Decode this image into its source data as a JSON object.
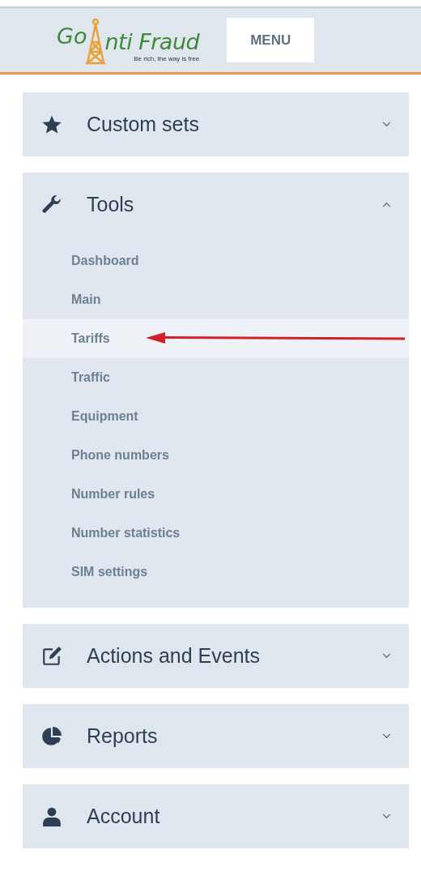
{
  "header": {
    "logo": {
      "part_1": "Go",
      "part_2": "nti Fraud",
      "tagline": "Be rich, the way is free"
    },
    "menu_button": "MENU"
  },
  "sections": [
    {
      "title": "Custom sets",
      "kind": "star",
      "expanded": false
    },
    {
      "title": "Tools",
      "kind": "wrench",
      "expanded": true,
      "items": [
        {
          "label": "Dashboard",
          "selected": false
        },
        {
          "label": "Main",
          "selected": false
        },
        {
          "label": "Tariffs",
          "selected": true
        },
        {
          "label": "Traffic",
          "selected": false
        },
        {
          "label": "Equipment",
          "selected": false
        },
        {
          "label": "Phone numbers",
          "selected": false
        },
        {
          "label": "Number rules",
          "selected": false
        },
        {
          "label": "Number statistics",
          "selected": false
        },
        {
          "label": "SIM settings",
          "selected": false
        }
      ]
    },
    {
      "title": "Actions and Events",
      "kind": "edit",
      "expanded": false
    },
    {
      "title": "Reports",
      "kind": "pie",
      "expanded": false
    },
    {
      "title": "Account",
      "kind": "user",
      "expanded": false
    }
  ]
}
